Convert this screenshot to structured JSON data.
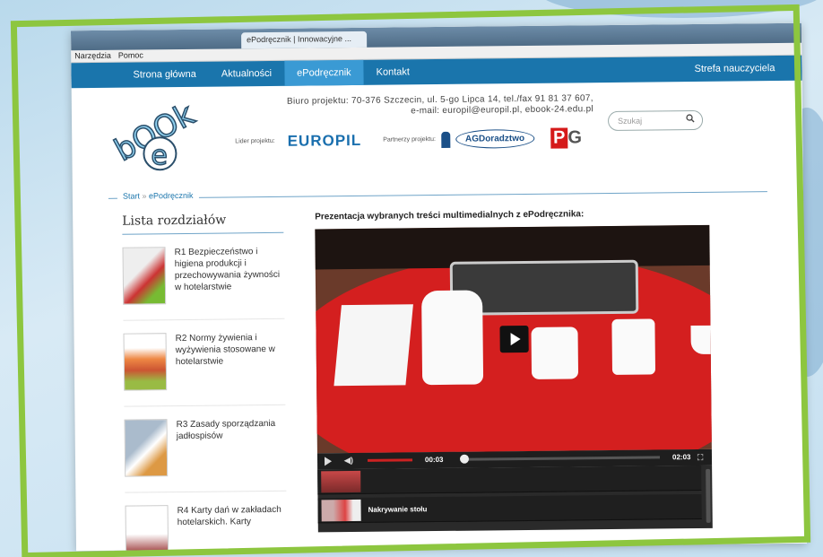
{
  "browser": {
    "tab_title": "ePodręcznik | Innowacyjne ...",
    "menu": [
      "Narzędzia",
      "Pomoc"
    ]
  },
  "nav": {
    "items": [
      "Strona główna",
      "Aktualności",
      "ePodręcznik",
      "Kontakt"
    ],
    "active": "ePodręcznik",
    "right": "Strefa nauczyciela"
  },
  "header": {
    "office_line1": "Biuro projektu: 70-376 Szczecin, ul. 5-go Lipca 14, tel./fax 91 81 37 607,",
    "office_line2": "e-mail: europil@europil.pl, ebook-24.edu.pl",
    "leader_label": "Lider projektu:",
    "leader_name": "EUROPIL",
    "partners_label": "Partnerzy projektu:",
    "partner1": "AGDoradztwo",
    "partner2_p": "P",
    "partner2_g": "G"
  },
  "search": {
    "placeholder": "Szukaj"
  },
  "breadcrumb": {
    "start": "Start",
    "separator": "»",
    "current": "ePodręcznik"
  },
  "sidebar": {
    "title": "Lista rozdziałów",
    "chapters": [
      {
        "label": "R1 Bezpieczeństwo i higiena produkcji i przechowywania żywności w hotelarstwie"
      },
      {
        "label": "R2 Normy żywienia i wyżywienia stosowane w hotelarstwie"
      },
      {
        "label": "R3 Zasady sporządzania jadłospisów"
      },
      {
        "label": "R4 Karty dań w zakładach hotelarskich. Karty"
      }
    ]
  },
  "main": {
    "title": "Prezentacja wybranych treści multimedialnych z ePodręcznika:",
    "video": {
      "current_time": "00:03",
      "duration": "02:03",
      "progress": 0.02
    },
    "playlist": [
      "",
      "Nakrywanie stołu"
    ]
  },
  "colors": {
    "nav_bg": "#1a75ac",
    "nav_active": "#3a9ad4",
    "frame_green": "#8dc63f",
    "table_red": "#d41f1f"
  }
}
